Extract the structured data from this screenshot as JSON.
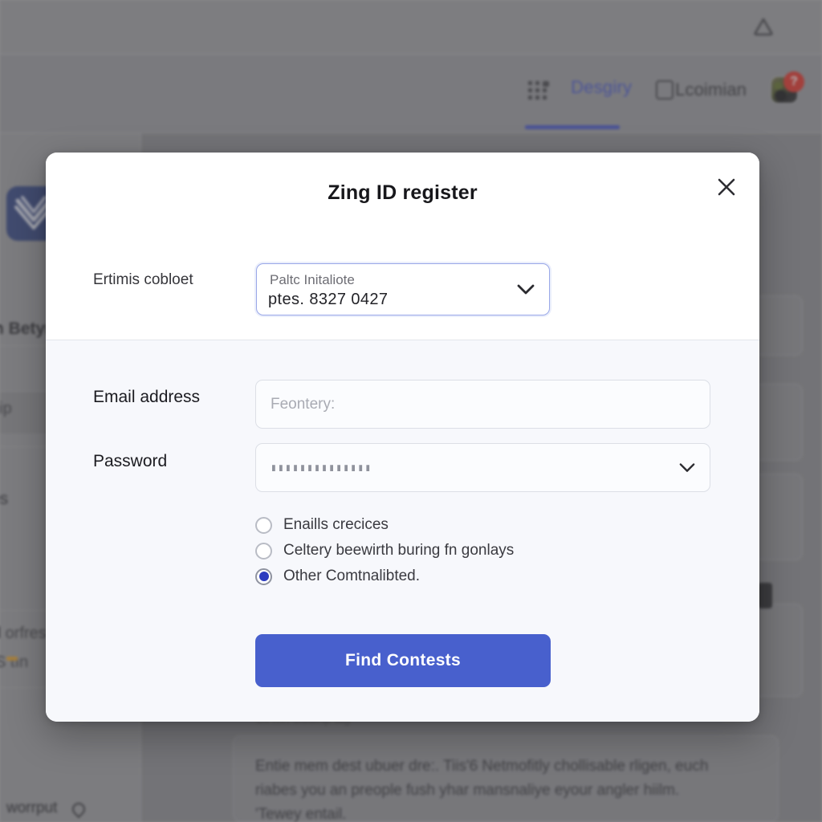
{
  "app": {
    "topbar": {
      "icon": "triangle-icon"
    },
    "nav": {
      "apps_icon": "apps-grid-icon",
      "active_tab": "Desgiry",
      "checkbox_label": "Lcoimian",
      "avatar_badge": "?"
    },
    "sidebar": {
      "logo_icon": "heart-chevron-logo",
      "items": [
        {
          "label": "n Betyn"
        },
        {
          "label": "uip"
        },
        {
          "label": "es"
        },
        {
          "label": "d orfres"
        },
        {
          "label": "S tın"
        }
      ],
      "footer_label": "worrput",
      "footer_icon": "location-pin-icon"
    },
    "content": {
      "small_note": "Cll mn siuuinp alg",
      "paragraph": "Entie mem dest ubuer dre:. Tiis'6 Netmofitly chollisable rligen, euch riabes you an preople fush yhar mansnaliye eyour angler hiilm. 'Tewey entail."
    }
  },
  "dialog": {
    "title": "Zing ID register",
    "close_icon": "close-icon",
    "top_row": {
      "label": "Ertimis cobloet",
      "select": {
        "line1": "Paltc Initaliote",
        "line2": "ptes.  8327 0427",
        "chevron_icon": "chevron-down-icon"
      }
    },
    "fields": [
      {
        "label": "Email address",
        "name": "email",
        "placeholder": "Feontery:",
        "value": ""
      },
      {
        "label": "Password",
        "name": "password",
        "value": "••••••••••••••",
        "masked_display": "▮▮▮▮▮▮▮▮▮▮▮▮▮▮",
        "chevron_icon": "chevron-down-icon"
      }
    ],
    "radios": [
      {
        "label": "Enaills crecices",
        "checked": false
      },
      {
        "label": "Celtery beewirth buring fn gonlays",
        "checked": false
      },
      {
        "label": "Other Comtnalibted.",
        "checked": true
      }
    ],
    "submit_label": "Find Contests"
  },
  "colors": {
    "accent_blue": "#4860cd",
    "tab_blue": "#4050c8",
    "radio_selected": "#2b3bbf",
    "badge_red": "#e02b20",
    "logo_navy": "#2e3f7f",
    "dialog_body_bg": "#f7f8fc"
  }
}
